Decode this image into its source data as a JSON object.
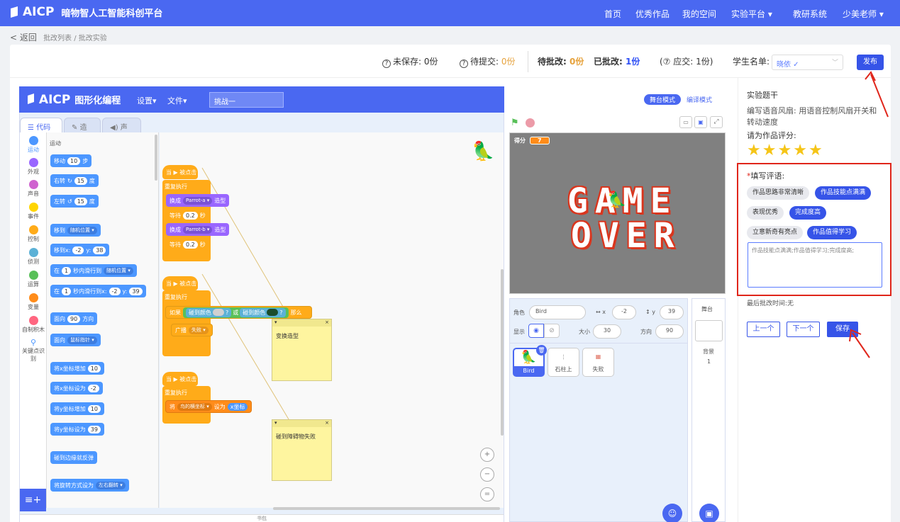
{
  "topnav": {
    "brand": "AICP",
    "brand_sub": "暗物智人工智能科创平台",
    "items": [
      "首页",
      "优秀作品",
      "我的空间",
      "实验平台 ▾",
      "教研系统",
      "少美老师 ▾"
    ]
  },
  "breadcrumb": {
    "back": "< 返回",
    "path": "批改列表 / 批改实验"
  },
  "status": {
    "unsaved_label": "未保存:",
    "unsaved_value": "0份",
    "pending_submit_label": "待提交:",
    "pending_submit_value": "0份",
    "to_grade_label": "待批改:",
    "to_grade_value": "0份",
    "graded_label": "已批改:",
    "graded_value": "1份",
    "should_submit": "(⑦ 应交: 1份)",
    "student_list_label": "学生名单:",
    "student_selected": "晓依 ✓",
    "publish": "发布"
  },
  "editor": {
    "brand": "AICP",
    "brand_sub": "图形化编程",
    "menu_settings": "设置▾",
    "menu_file": "文件▾",
    "project_title": "挑战一",
    "tab_code": "代码",
    "tab_costume": "造型",
    "tab_sound": "声音",
    "stage_mode": "舞台模式",
    "edit_mode": "编译模式",
    "categories": [
      {
        "label": "运动",
        "color": "#4c97ff"
      },
      {
        "label": "外观",
        "color": "#9966ff"
      },
      {
        "label": "声音",
        "color": "#cf63cf"
      },
      {
        "label": "事件",
        "color": "#ffd500"
      },
      {
        "label": "控制",
        "color": "#ffab19"
      },
      {
        "label": "侦测",
        "color": "#5cb1d6"
      },
      {
        "label": "运算",
        "color": "#59c059"
      },
      {
        "label": "变量",
        "color": "#ff8c1a"
      },
      {
        "label": "自制积木",
        "color": "#ff6680"
      },
      {
        "label": "关键点识别",
        "color": "#4c97ff"
      }
    ],
    "palette_title": "运动",
    "palette": {
      "move": "移动",
      "move_n": "10",
      "steps": "步",
      "turn_r": "右转",
      "turn_l": "左转",
      "deg_n": "15",
      "deg": "度",
      "goto": "移到",
      "goto_dd": "随机位置 ▾",
      "gotoxy": "移到x:",
      "x_val": "-2",
      "y_lbl": "y:",
      "y_val": "38",
      "glide": "在",
      "glide_n": "1",
      "glide_to": "秒内滑行到",
      "glide_dd": "随机位置 ▾",
      "glide2": "秒内滑行到x:",
      "glide2_x": "-2",
      "glide2_y": "39",
      "face": "面向",
      "face_n": "90",
      "face_dir": "方向",
      "face_to": "面向",
      "face_dd": "鼠标指针 ▾",
      "chx": "将x坐标增加",
      "chx_n": "10",
      "setx": "将x坐标设为",
      "setx_n": "-2",
      "chy": "将y坐标增加",
      "chy_n": "10",
      "sety": "将y坐标设为",
      "sety_n": "39",
      "bounce": "碰到边缘就反弹",
      "rot": "将旋转方式设为",
      "rot_dd": "左右翻转 ▾"
    },
    "scripts": {
      "when_flag": "当 ▶ 被点击",
      "forever": "重复执行",
      "switch": "换成",
      "costume_a": "Parrot-a ▾",
      "costume_b": "Parrot-b ▾",
      "costume": "造型",
      "wait": "等待",
      "wait_n": "0.2",
      "sec": "秒",
      "if": "如果",
      "touch_color": "碰到颜色",
      "q": "?",
      "and": "或",
      "then": "那么",
      "broadcast": "广播",
      "broadcast_dd": "失败 ▾",
      "set": "将",
      "set_dd": "鸟的横坐标 ▾",
      "set_to": "设为",
      "set_val": "x坐标",
      "note1": "变换造型",
      "note2": "碰到障碍物失败"
    },
    "score_label": "得分",
    "score_value": "7",
    "gameover_1": "GAME",
    "gameover_2": "OVER",
    "sprite": {
      "role_label": "角色",
      "name": "Bird",
      "x_label": "x",
      "x": "-2",
      "y_label": "y",
      "y": "39",
      "show_label": "显示",
      "size_label": "大小",
      "size": "30",
      "dir_label": "方向",
      "dir": "90",
      "thumbs": [
        "Bird",
        "石柱上",
        "失败"
      ]
    },
    "stage_panel": {
      "title": "舞台",
      "backdrop_label": "背景",
      "backdrop_count": "1"
    },
    "bottom_label": "书包"
  },
  "right_panel": {
    "title": "实验题干",
    "desc": "编写语音风扇: 用语音控制风扇开关和转动速度",
    "rate_label": "请为作品评分:",
    "stars": 5,
    "comment_label": "填写评语:",
    "required_mark": "*",
    "chips": [
      {
        "label": "作品思路非常清晰",
        "selected": false
      },
      {
        "label": "作品技能点满满",
        "selected": true
      },
      {
        "label": "表现优秀",
        "selected": false
      },
      {
        "label": "完成度高",
        "selected": true
      },
      {
        "label": "立意新奇有亮点",
        "selected": false
      },
      {
        "label": "作品值得学习",
        "selected": true
      }
    ],
    "comment_text": "作品技能点满满;作品值得学习;完成度高;",
    "last_graded": "最后批改时间:无",
    "prev": "上一个",
    "next": "下一个",
    "save": "保存"
  }
}
